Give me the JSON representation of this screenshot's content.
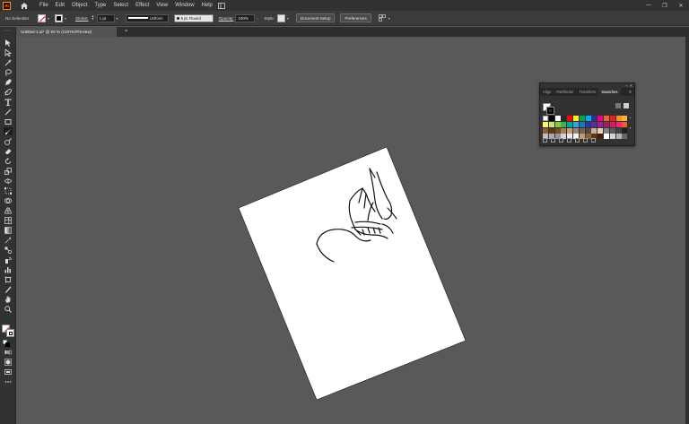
{
  "app": {
    "badge": "Ai"
  },
  "menu": [
    "File",
    "Edit",
    "Object",
    "Type",
    "Select",
    "Effect",
    "View",
    "Window",
    "Help"
  ],
  "window_controls": {
    "minimize": "—",
    "restore": "❐",
    "close": "✕"
  },
  "control_bar": {
    "selection": "No Selection",
    "stroke_label": "Stroke:",
    "stroke_weight": "1 pt",
    "profile": "Uniform",
    "brush": "5 pt. Round",
    "opacity_label": "Opacity:",
    "opacity": "100%",
    "style_label": "Style:",
    "document_setup": "Document Setup",
    "preferences": "Preferences"
  },
  "document_tab": {
    "title": "Untitled-1.ai* @ 50 % (CMYK/Preview)",
    "close": "×"
  },
  "tools": [
    "selection-tool",
    "direct-selection-tool",
    "magic-wand-tool",
    "lasso-tool",
    "pen-tool",
    "curvature-tool",
    "type-tool",
    "line-tool",
    "rectangle-tool",
    "paintbrush-tool",
    "shaper-tool",
    "eraser-tool",
    "rotate-tool",
    "scale-tool",
    "width-tool",
    "free-transform-tool",
    "shape-builder-tool",
    "perspective-grid-tool",
    "mesh-tool",
    "gradient-tool",
    "eyedropper-tool",
    "blend-tool",
    "symbol-sprayer-tool",
    "column-graph-tool",
    "artboard-tool",
    "slice-tool",
    "hand-tool",
    "zoom-tool"
  ],
  "swatches_panel": {
    "tabs": [
      "Align",
      "Pathfinder",
      "Transform",
      "Swatches"
    ],
    "active_tab": "Swatches",
    "menu": "≡",
    "swatch_colors": [
      "#ffffff",
      "#000000",
      "#ffffff",
      "#2b2b2b",
      "#ff0000",
      "#fff200",
      "#00a651",
      "#00aeef",
      "#2e3192",
      "#ec008c",
      "#f26522",
      "#ed1c24",
      "#f7941d",
      "#fbaf3f",
      "#fff568",
      "#c5e17a",
      "#8dc63f",
      "#39b54a",
      "#00a99d",
      "#27aae1",
      "#1c75bc",
      "#2b3990",
      "#662d91",
      "#92278f",
      "#9e1f63",
      "#da1c5c",
      "#ee2a7b",
      "#f15a29",
      "#8b5e3c",
      "#603913",
      "#754c24",
      "#a97c50",
      "#c69c6d",
      "#998675",
      "#736357",
      "#534741",
      "#c7b299",
      "#e6d3b3",
      "#808285",
      "#58595b",
      "#414042",
      "#231f20",
      "#bcbec0",
      "#a7a9ac",
      "#939598",
      "#d1d3d4",
      "#e6e7e8",
      "#f1f2f2",
      "#c49a6c",
      "#8c6239",
      "#603813",
      "#42210b",
      "#ffffff",
      "#d4d4d4",
      "#b3b3b3",
      "#666666"
    ]
  }
}
